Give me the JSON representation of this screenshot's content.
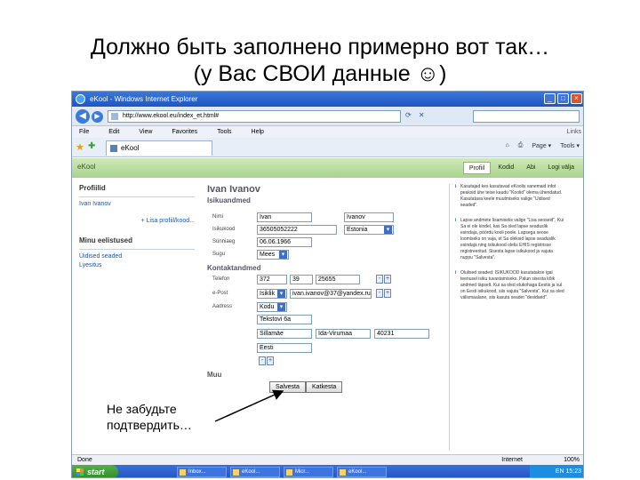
{
  "slide": {
    "title_line1": "Должно быть заполнено примерно вот так…",
    "title_line2": "(у Вас СВОИ данные ☺)",
    "callout_line1": "Не забудьте",
    "callout_line2": "подтвердить…"
  },
  "browser": {
    "window_title": "eKool - Windows Internet Explorer",
    "url": "http://www.ekool.eu/index_et.html#",
    "menu": [
      "File",
      "Edit",
      "View",
      "Favorites",
      "Tools",
      "Help"
    ],
    "menu_right": "Links",
    "tab_title": "eKool",
    "commands": [
      "Page ▾",
      "Tools ▾"
    ],
    "status_left": "Done",
    "status_zone": "Internet",
    "zoom": "100%"
  },
  "site": {
    "brand": "eKool",
    "nav": [
      "Profiil",
      "Kodid",
      "Abi",
      "Logi välja"
    ],
    "active_nav": "Profiil"
  },
  "left": {
    "header": "Profiilid",
    "profile_link": "Ivan Ivanov",
    "add_profile": "+ Lisa profiil/kood...",
    "settings_header": "Minu eelistused",
    "links": [
      "Uidised seaded",
      "Lyesitus"
    ]
  },
  "form": {
    "person_name": "Ivan Ivanov",
    "section_personal": "Isikuandmed",
    "name_label": "Nimi",
    "first_name": "Ivan",
    "last_name": "Ivanov",
    "id_label": "Isikukood",
    "id_code": "36505052222",
    "country": "Estonia",
    "birth_label": "Sünniaeg",
    "birth_date": "06.06.1966",
    "gender_label": "Sugu",
    "gender": "Mees",
    "section_contact": "Kontaktandmed",
    "phone_label": "Telefon",
    "phone_code": "372",
    "phone_area": "39",
    "phone_number": "25655",
    "email_label": "e-Post",
    "email_type": "Isiklik",
    "email": "ivan.ivanov@37@yandex.ru",
    "address_label": "Aadress",
    "address_type": "Kodu",
    "street": "Tekstovi 6a",
    "city": "Sillamäe",
    "county": "Ida-Virumaa",
    "postcode": "40231",
    "address_country": "Eesti",
    "section_other": "Muu",
    "save_button": "Salvesta",
    "cancel_button": "Katkesta"
  },
  "help_notes": [
    "Kasutajad kes kasutavad eKoolis vanemaid infot peaksid ühe teise kaudu \"Koolid\" olema ühendatud. Kasutatava keele muutmiseks valige \"Uidised seaded\".",
    "Lapse andmete lisamiseks valige \"Lisa seoseid\". Kui Sa ei ole kindel, kas Sa oled lapse seaduslik esindaja, pöördu kooli poole. Lapsega seose loomiseks on vaja, et Sa oleksid lapse seaduslik esindaja ning isikukood oleks EHIS registrisse registreeritud. Sisesta lapse isikukood ja vajuta nuppu \"Salvesta\".",
    "Olulised seaded: ISIKUKOOD kasutatakse igal teenusel isiku tuvastamiseks. Palun sisesta kõik andmed täpselt. Kui sa oled elukohaga Eestis ja sul on Eesti isikukood, siis vajuta \"Salvesta\". Kui sa oled välismaalane, siis kasuta seadet \"desidarid\"."
  ],
  "taskbar": {
    "start_label": "start",
    "items": [
      "Inbox...",
      "eKool...",
      "Micr...",
      "eKool..."
    ],
    "tray": "EN 15:23"
  }
}
